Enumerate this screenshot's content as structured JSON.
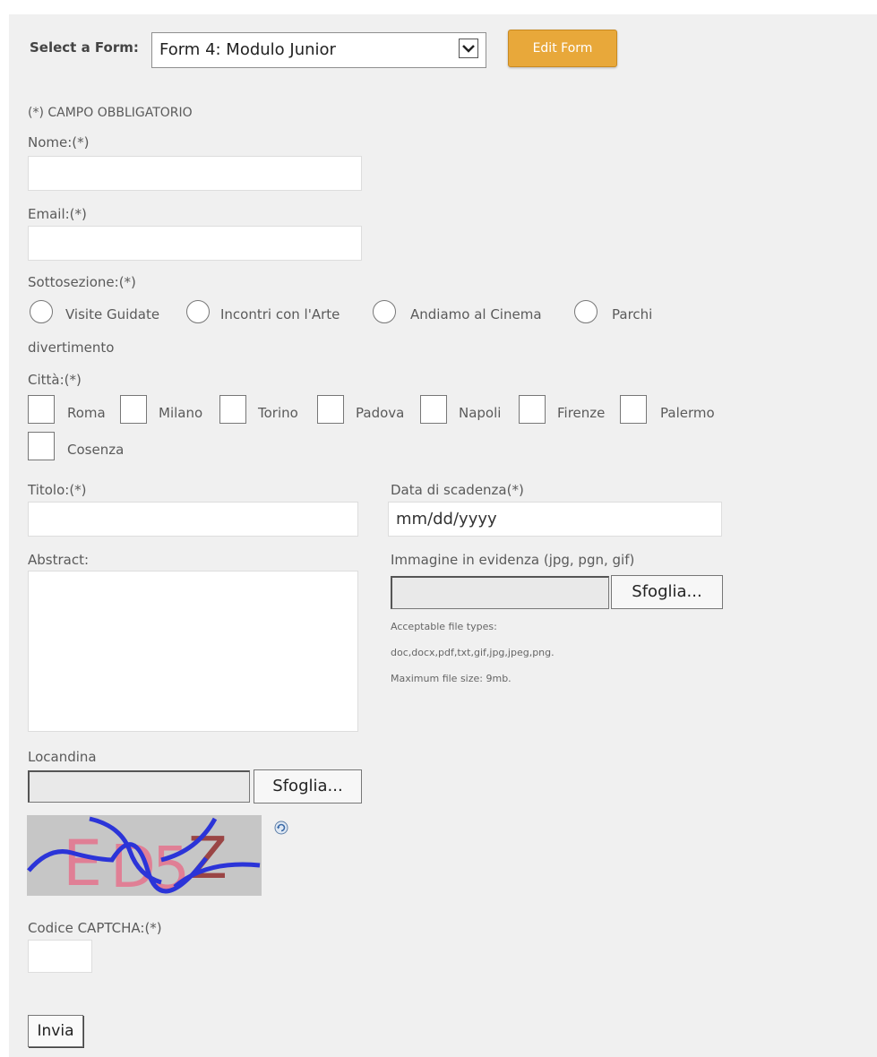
{
  "header": {
    "select_label": "Select a Form:",
    "selected_form": "Form 4: Modulo Junior",
    "edit_button": "Edit Form"
  },
  "form": {
    "required_note": "(*) CAMPO OBBLIGATORIO",
    "nome_label": "Nome:(*)",
    "email_label": "Email:(*)",
    "sottosezione_label": "Sottosezione:(*)",
    "sottosezione_options": [
      "Visite Guidate",
      "Incontri con l'Arte",
      "Andiamo al Cinema",
      "Parchi"
    ],
    "sottosezione_wrap": "divertimento",
    "citta_label": "Città:(*)",
    "citta_options": [
      "Roma",
      "Milano",
      "Torino",
      "Padova",
      "Napoli",
      "Firenze",
      "Palermo",
      "Cosenza"
    ],
    "titolo_label": "Titolo:(*)",
    "data_scadenza_label": "Data di scadenza(*)",
    "data_scadenza_placeholder": "mm/dd/yyyy",
    "abstract_label": "Abstract:",
    "immagine_label": "Immagine in evidenza (jpg, pgn, gif)",
    "browse_label": "Sfoglia...",
    "file_types_line1": "Acceptable file types:",
    "file_types_line2": "doc,docx,pdf,txt,gif,jpg,jpeg,png.",
    "max_size": "Maximum file size: 9mb.",
    "locandina_label": "Locandina",
    "captcha_text": "ED5Z",
    "captcha_label": "Codice CAPTCHA:(*)",
    "submit_label": "Invia"
  },
  "icons": {
    "dropdown": "chevron-down-icon",
    "refresh": "refresh-icon"
  },
  "colors": {
    "panel_bg": "#f0f0f0",
    "edit_button_bg": "#e8a83a"
  }
}
